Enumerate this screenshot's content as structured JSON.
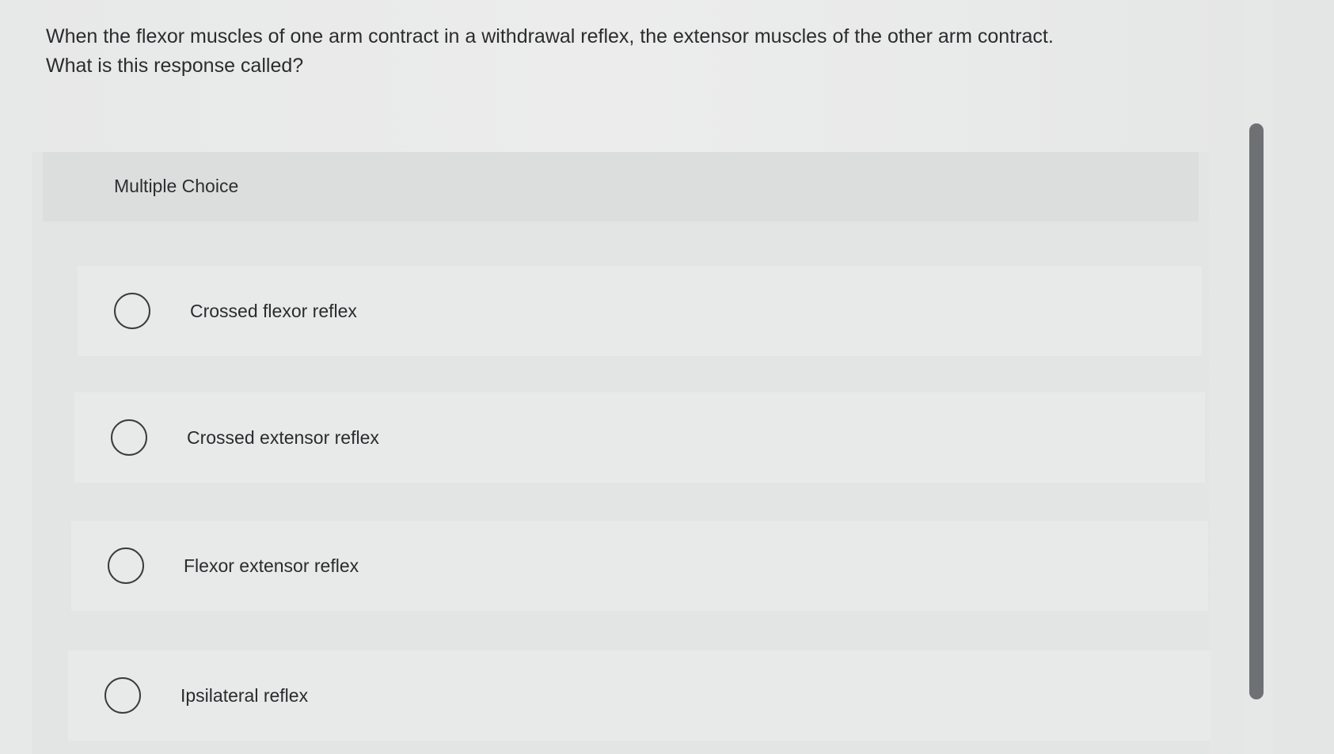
{
  "question": {
    "line1": "When the flexor muscles of one arm contract in a withdrawal reflex, the extensor muscles of the other arm contract.",
    "line2": "What is this response called?"
  },
  "multiple_choice": {
    "label": "Multiple Choice",
    "options": [
      {
        "label": "Crossed flexor reflex",
        "selected": false
      },
      {
        "label": "Crossed extensor reflex",
        "selected": false
      },
      {
        "label": "Flexor extensor reflex",
        "selected": false
      },
      {
        "label": "Ipsilateral reflex",
        "selected": false
      }
    ]
  }
}
